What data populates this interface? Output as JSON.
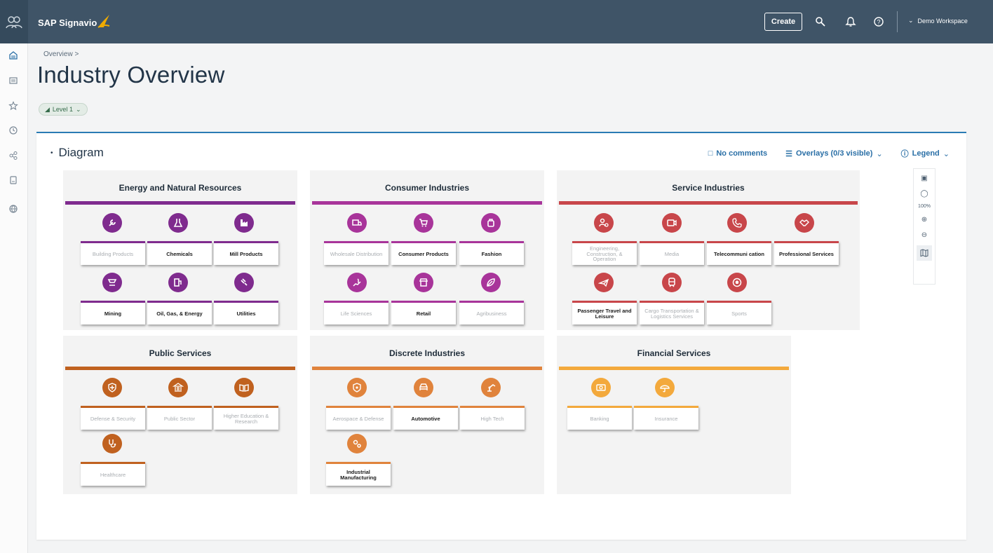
{
  "topbar": {
    "brand": "SAP Signavio",
    "create_label": "Create",
    "workspace": "Demo Workspace"
  },
  "breadcrumb": "Overview  >",
  "page_title": "Industry Overview",
  "level_chip": "Level 1",
  "card": {
    "title": "Diagram",
    "comments": "No comments",
    "overlays": "Overlays (0/3 visible)",
    "legend": "Legend",
    "zoom_pct": "100%"
  },
  "colors": {
    "energy": "#7f2b8e",
    "consumer": "#a8349a",
    "service": "#c8464a",
    "public": "#c0611f",
    "discrete": "#e0833c",
    "financial": "#f3a93c"
  },
  "groups": {
    "energy": {
      "title": "Energy and Natural Resources",
      "tiles": [
        "Building Products",
        "Chemicals",
        "Mill Products",
        "Mining",
        "Oil, Gas, & Energy",
        "Utilities"
      ],
      "icons": [
        "wrench-icon",
        "flask-icon",
        "factory-icon",
        "cart-anvil-icon",
        "fuel-pump-icon",
        "plug-icon"
      ]
    },
    "consumer": {
      "title": "Consumer Industries",
      "tiles": [
        "Wholesale Distribution",
        "Consumer Products",
        "Fashion",
        "Life Sciences",
        "Retail",
        "Agribusiness"
      ],
      "icons": [
        "truck-icon",
        "cart-icon",
        "bag-icon",
        "hand-dna-icon",
        "store-icon",
        "leaf-icon"
      ]
    },
    "service": {
      "title": "Service Industries",
      "tiles": [
        "Engineering, Construction, & Operation",
        "Media",
        "Telecommuni cation",
        "Professional Services",
        "Passenger Travel and Leisure",
        "Cargo Transportation & Logistics Services",
        "Sports"
      ],
      "icons": [
        "people-gear-icon",
        "video-icon",
        "phone-icon",
        "handshake-icon",
        "plane-icon",
        "train-icon",
        "ball-icon"
      ]
    },
    "public": {
      "title": "Public Services",
      "tiles": [
        "Defense & Security",
        "Public Sector",
        "Higher Education & Research",
        "Healthcare"
      ],
      "icons": [
        "shield-icon",
        "building-icon",
        "book-icon",
        "stethoscope-icon"
      ]
    },
    "discrete": {
      "title": "Discrete Industries",
      "tiles": [
        "Aerospace & Defense",
        "Automotive",
        "High Tech",
        "Industrial Manufacturing"
      ],
      "icons": [
        "badge-icon",
        "car-icon",
        "robot-arm-icon",
        "gears-icon"
      ]
    },
    "financial": {
      "title": "Financial Services",
      "tiles": [
        "Banking",
        "Insurance"
      ],
      "icons": [
        "money-icon",
        "umbrella-icon"
      ]
    }
  }
}
